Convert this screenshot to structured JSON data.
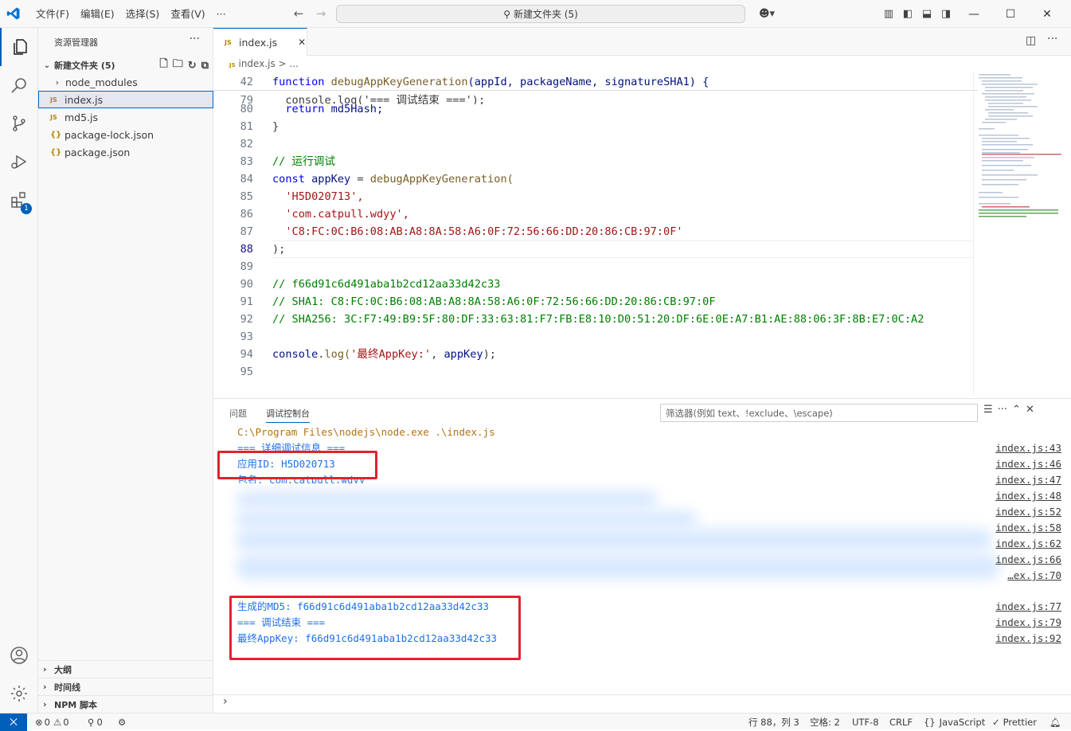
{
  "menu": [
    "文件(F)",
    "编辑(E)",
    "选择(S)",
    "查看(V)",
    "···"
  ],
  "search_text": "新建文件夹 (5)",
  "sidebar": {
    "title": "资源管理器",
    "folder": "新建文件夹 (5)",
    "files": [
      "node_modules",
      "index.js",
      "md5.js",
      "package-lock.json",
      "package.json"
    ],
    "sections": [
      "大纲",
      "时间线",
      "NPM 脚本"
    ]
  },
  "extensions_badge": "1",
  "editor": {
    "tab_label": "index.js",
    "breadcrumb": "index.js > ...",
    "lines": {
      "l42": "42",
      "l79": "79",
      "l80": "80",
      "l81": "81",
      "l82": "82",
      "l83": "83",
      "l84": "84",
      "l85": "85",
      "l86": "86",
      "l87": "87",
      "l88": "88",
      "l89": "89",
      "l90": "90",
      "l91": "91",
      "l92": "92",
      "l93": "93",
      "l94": "94",
      "l95": "95"
    },
    "code": {
      "c42_fn": "debugAppKeyGeneration",
      "c42_params": "(appId, packageName, signatureSHA1) {",
      "c79": "console.log('=== 调试结束 ===');",
      "c80_ret": "return",
      "c80_var": "md5Hash;",
      "c81": "}",
      "c83": "// 运行调试",
      "c84_var": "appKey",
      "c84_fn": "debugAppKeyGeneration(",
      "c85": "'H5D020713',",
      "c86": "'com.catpull.wdyy',",
      "c87": "'C8:FC:0C:B6:08:AB:A8:8A:58:A6:0F:72:56:66:DD:20:86:CB:97:0F'",
      "c88": ");",
      "c90": "// f66d91c6d491aba1b2cd12aa33d42c33",
      "c91": "// SHA1: C8:FC:0C:B6:08:AB:A8:8A:58:A6:0F:72:56:66:DD:20:86:CB:97:0F",
      "c92": "// SHA256: 3C:F7:49:B9:5F:80:DF:33:63:81:F7:FB:E8:10:D0:51:20:DF:6E:0E:A7:B1:AE:88:06:3F:8B:E7:0C:A2",
      "c94_obj": "console",
      "c94_fn": "log(",
      "c94_str": "'最终AppKey:'",
      "c94_var": "appKey",
      "c94_end": ");"
    },
    "kw_function": "function",
    "kw_const": "const"
  },
  "panel": {
    "tabs": [
      "问题",
      "调试控制台"
    ],
    "filter_placeholder": "筛选器(例如 text、!exclude、\\escape)",
    "output": {
      "cmd": "C:\\Program Files\\nodejs\\node.exe .\\index.js",
      "o1": "=== 详细调试信息 ===",
      "o2": "应用ID: H5D020713",
      "o3": "包名: com.catpull.wdyy",
      "o4": "生成的MD5: f66d91c6d491aba1b2cd12aa33d42c33",
      "o5": "=== 调试结束 ===",
      "o6": "最终AppKey: f66d91c6d491aba1b2cd12aa33d42c33"
    },
    "refs": [
      "index.js:43",
      "index.js:46",
      "index.js:47",
      "index.js:48",
      "index.js:52",
      "index.js:58",
      "index.js:62",
      "index.js:66",
      "…ex.js:70",
      "index.js:77",
      "index.js:79",
      "index.js:92"
    ]
  },
  "status": {
    "errors": "0",
    "warnings": "0",
    "ports": "0",
    "position": "行 88，列 3",
    "spaces": "空格: 2",
    "encoding": "UTF-8",
    "eol": "CRLF",
    "language": "JavaScript",
    "formatter": "Prettier"
  },
  "colors": {
    "accent": "#005fb8",
    "highlight_box": "#e0232e",
    "keyword": "#0000ff",
    "string": "#a31515",
    "comment": "#008000"
  }
}
